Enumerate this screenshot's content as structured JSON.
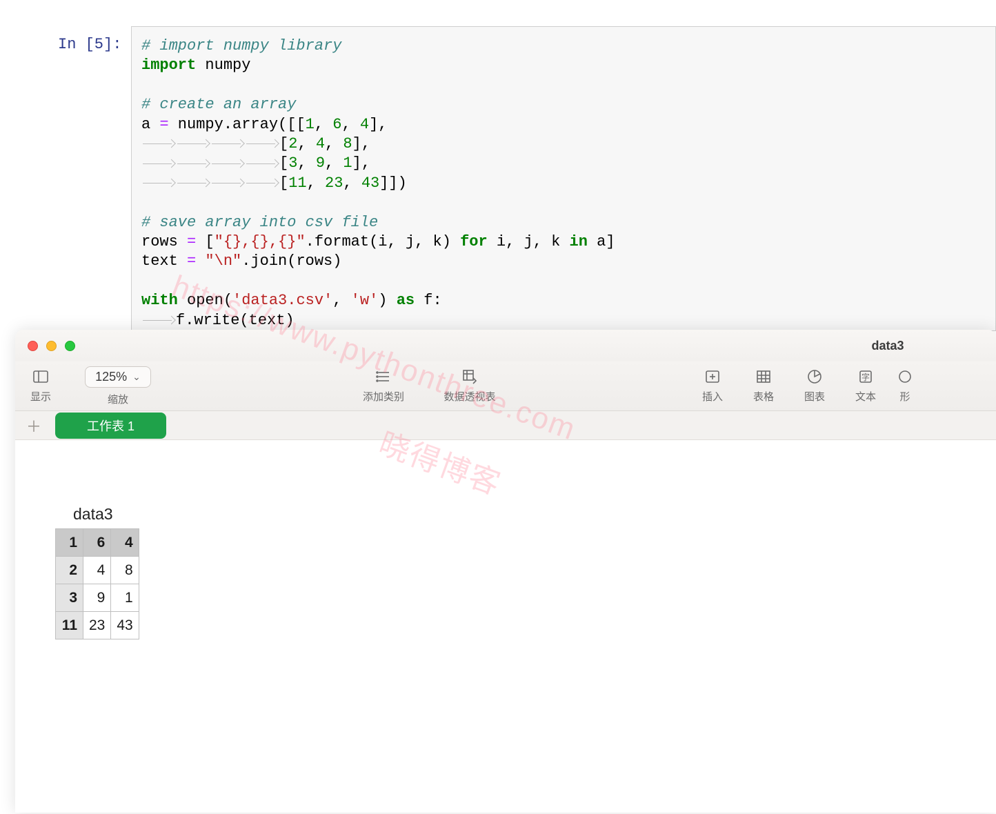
{
  "jupyter": {
    "prompt": "In [5]:",
    "code": {
      "c1": "# import numpy library",
      "kw_import": "import",
      "mod": "numpy",
      "c2": "# create an array",
      "arr_assign": "a ",
      "op_eq": "=",
      "arr_call": " numpy.array([[",
      "n1": "1",
      "n2": "6",
      "n3": "4",
      "row_close1": "],",
      "row_open": "[",
      "n4": "2",
      "n5": "4",
      "n6": "8",
      "n7": "3",
      "n8": "9",
      "n9": "1",
      "n10": "11",
      "n11": "23",
      "n12": "43",
      "row_close_last": "]])",
      "c3": "# save array into csv file",
      "rows_lhs": "rows ",
      "s_fmt": "\"{},{},{}\"",
      "fmt_tail": ".format(i, j, k) ",
      "kw_for": "for",
      "for_tail": " i, j, k ",
      "kw_in": "in",
      "in_tail": " a]",
      "text_lhs": "text ",
      "s_nl": "\"\\n\"",
      "join_tail": ".join(rows)",
      "kw_with": "with",
      "open_call": " open(",
      "s_file": "'data3.csv'",
      "s_mode": "'w'",
      "kw_as": "as",
      "as_tail": " f:",
      "write_line": "f.write(text)"
    }
  },
  "sheet": {
    "title": "data3",
    "toolbar": {
      "view": "显示",
      "zoom_value": "125%",
      "zoom_label": "缩放",
      "add_category": "添加类别",
      "pivot": "数据透视表",
      "insert": "插入",
      "table": "表格",
      "chart": "图表",
      "text": "文本",
      "shape": "形"
    },
    "tab": "工作表 1",
    "table_title": "data3",
    "data": [
      [
        1,
        6,
        4
      ],
      [
        2,
        4,
        8
      ],
      [
        3,
        9,
        1
      ],
      [
        11,
        23,
        43
      ]
    ]
  },
  "watermark": {
    "line1": "https://www.pythonthree.com",
    "line2": "晓得博客"
  }
}
